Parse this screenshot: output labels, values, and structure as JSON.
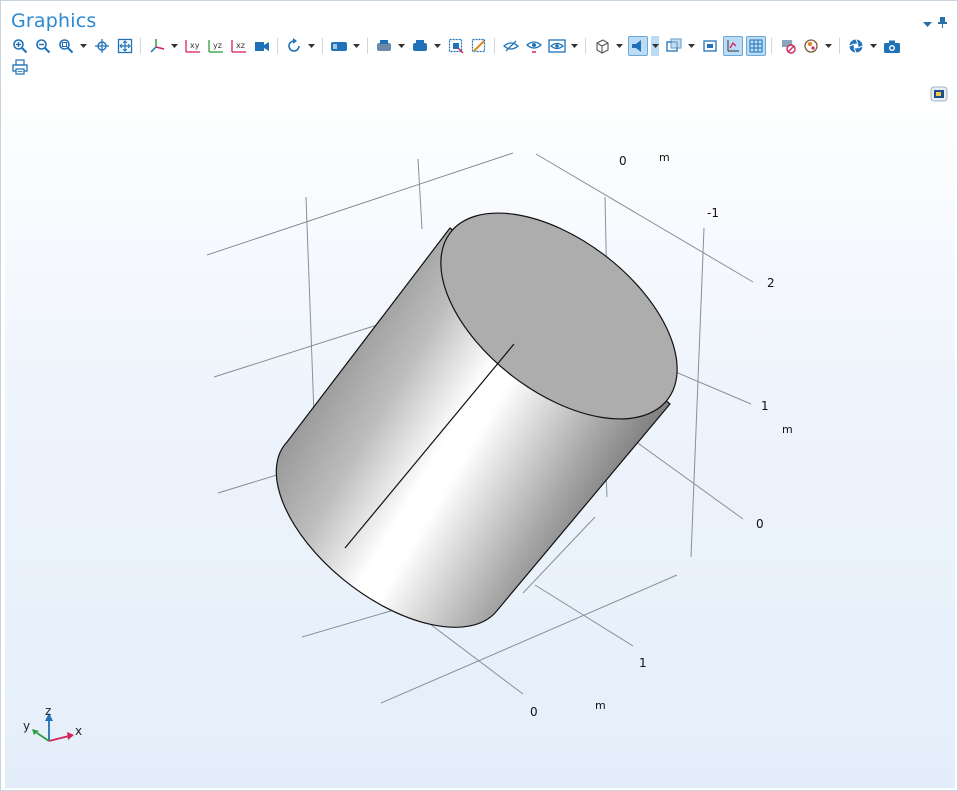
{
  "window": {
    "title": "Graphics"
  },
  "toolbar": {
    "buttons": [
      {
        "icon": "zoom-in-icon"
      },
      {
        "icon": "zoom-out-icon"
      },
      {
        "icon": "zoom-box-icon"
      },
      {
        "icon": "center-view-icon"
      },
      {
        "icon": "zoom-extents-icon"
      },
      {
        "icon": "axis-views-icon"
      },
      {
        "icon": "xy-view-icon"
      },
      {
        "icon": "yz-view-icon"
      },
      {
        "icon": "xz-view-icon"
      },
      {
        "icon": "camera-view-icon"
      },
      {
        "icon": "rotate-icon"
      },
      {
        "icon": "selection-box-icon"
      },
      {
        "icon": "select-objects-icon"
      },
      {
        "icon": "select-domains-icon"
      },
      {
        "icon": "zoom-selection-icon"
      },
      {
        "icon": "clear-selection-icon"
      },
      {
        "icon": "hide-icon"
      },
      {
        "icon": "show-hidden-icon"
      },
      {
        "icon": "visibility-icon"
      },
      {
        "icon": "wireframe-icon"
      },
      {
        "icon": "transparency-icon"
      },
      {
        "icon": "light-icon"
      },
      {
        "icon": "render-icon"
      },
      {
        "icon": "show-axis-icon"
      },
      {
        "icon": "grid-icon"
      },
      {
        "icon": "reset-hiding-icon"
      },
      {
        "icon": "scene-light-icon"
      },
      {
        "icon": "image-snapshot-icon"
      },
      {
        "icon": "camera-icon"
      },
      {
        "icon": "print-icon"
      }
    ]
  },
  "viewport": {
    "background_top": "#ffffff",
    "background_bottom": "#e4eefa",
    "axis_labels": {
      "top_zero": "0",
      "top_unit": "m",
      "top_neg1": "-1",
      "right_two": "2",
      "right_one": "1",
      "right_unit": "m",
      "right_zero": "0",
      "bottom_one": "1",
      "bottom_zero": "0",
      "bottom_unit": "m"
    },
    "triad": {
      "x": "x",
      "y": "y",
      "z": "z"
    }
  }
}
